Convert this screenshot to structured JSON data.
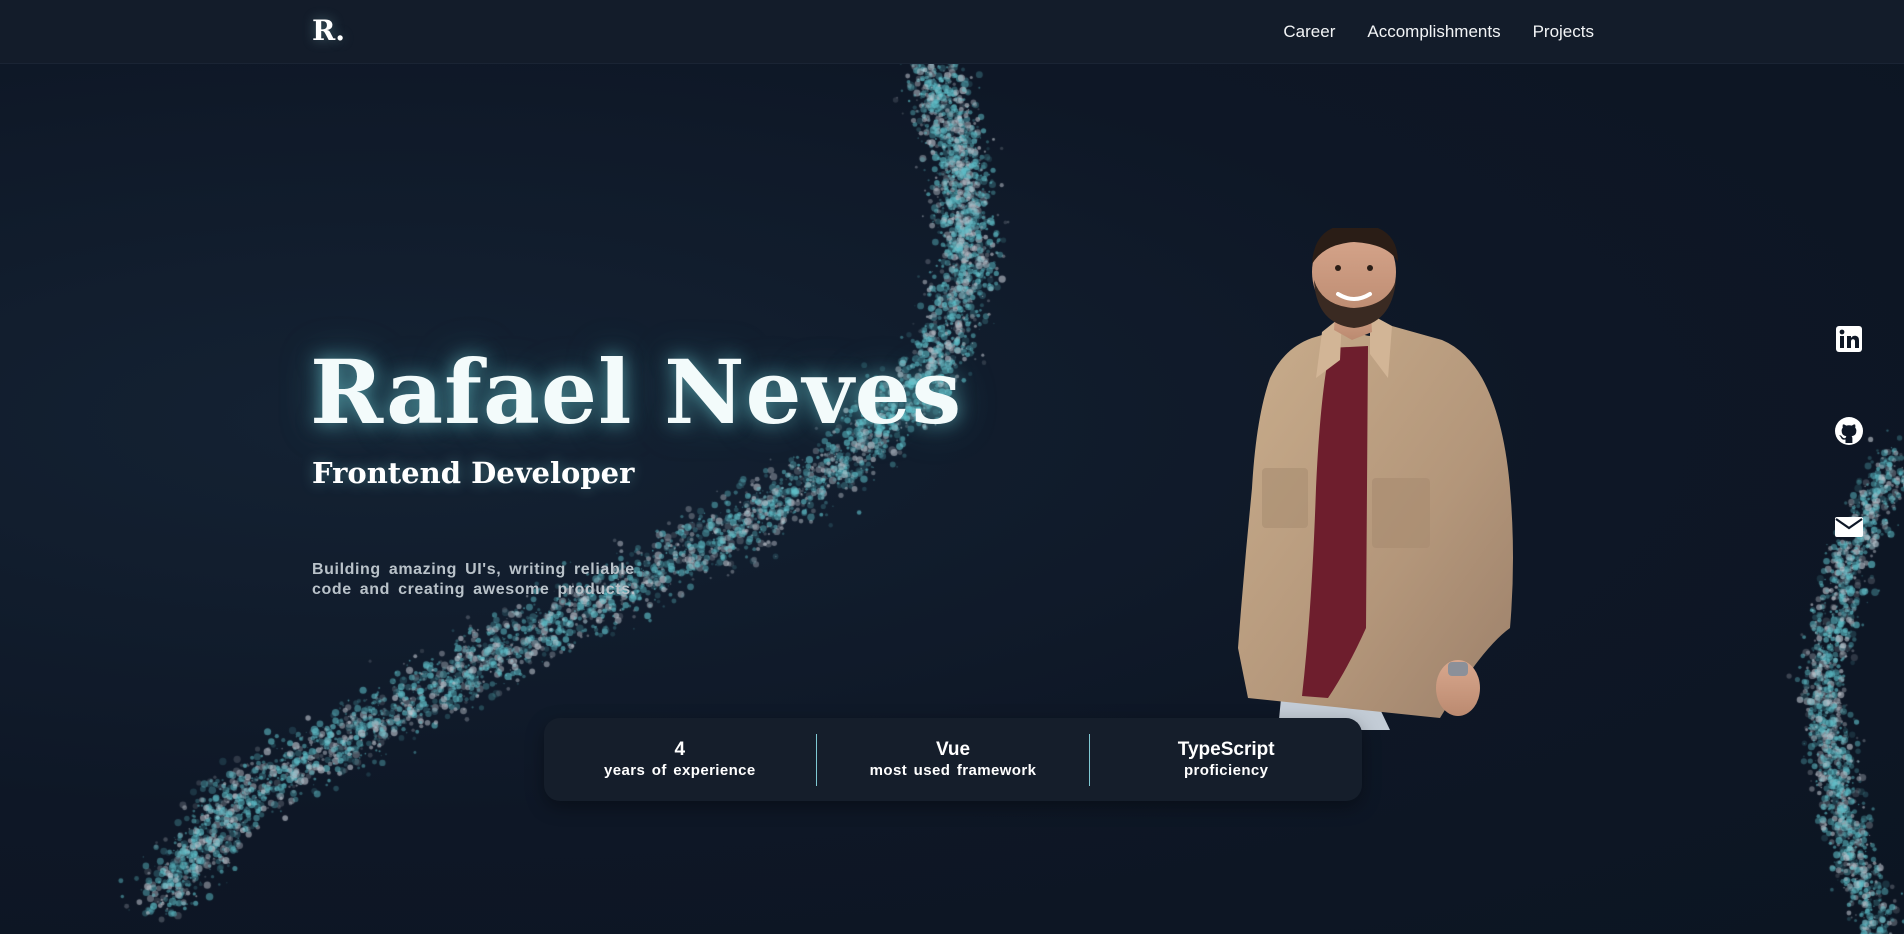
{
  "header": {
    "logo": "R.",
    "nav": [
      "Career",
      "Accomplishments",
      "Projects"
    ]
  },
  "hero": {
    "name": "Rafael Neves",
    "role": "Frontend Developer",
    "tagline": "Building amazing UI's, writing reliable code and creating awesome products."
  },
  "stats": [
    {
      "value": "4",
      "label": "years of experience"
    },
    {
      "value": "Vue",
      "label": "most used framework"
    },
    {
      "value": "TypeScript",
      "label": "proficiency"
    }
  ],
  "social": [
    "linkedin-icon",
    "github-icon",
    "mail-icon"
  ],
  "colors": {
    "background": "#0e1726",
    "header": "#131c2a",
    "accent": "#7fc9d3",
    "glow": "#78dce1",
    "stats_card": "#151e2b"
  }
}
